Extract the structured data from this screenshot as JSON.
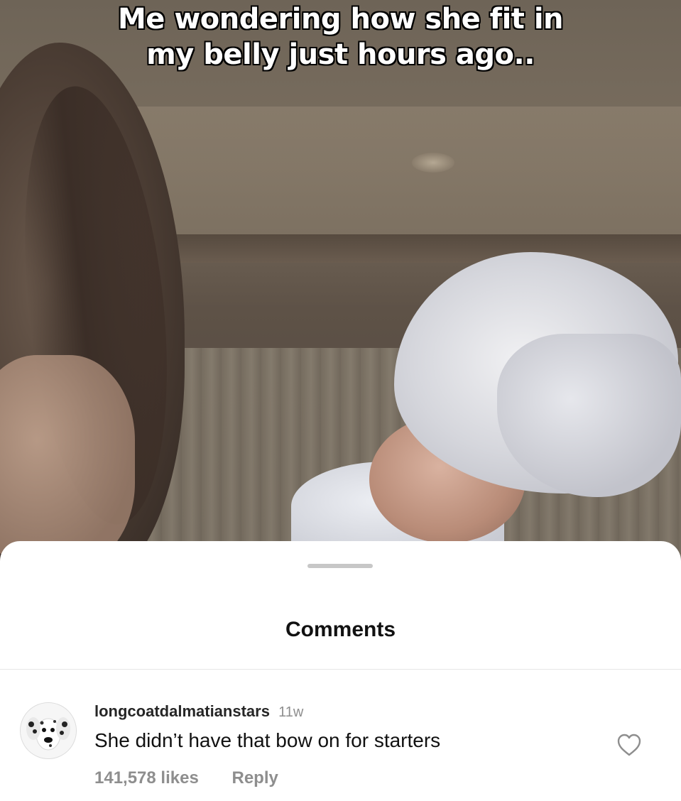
{
  "media": {
    "caption_lines": [
      "Me wondering how she fit in",
      "my belly just hours ago.."
    ]
  },
  "comments_sheet": {
    "title": "Comments",
    "comments": [
      {
        "author": "longcoatdalmatianstars",
        "age": "11w",
        "text": "She didn’t have that bow on for starters",
        "likes": "141,578 likes",
        "reply_label": "Reply",
        "avatar_icon": "dalmatian-dog-avatar",
        "like_icon": "heart-outline-icon"
      }
    ]
  },
  "colors": {
    "sheet_background": "#ffffff",
    "muted_text": "#8e8e8e",
    "primary_text": "#111111"
  }
}
